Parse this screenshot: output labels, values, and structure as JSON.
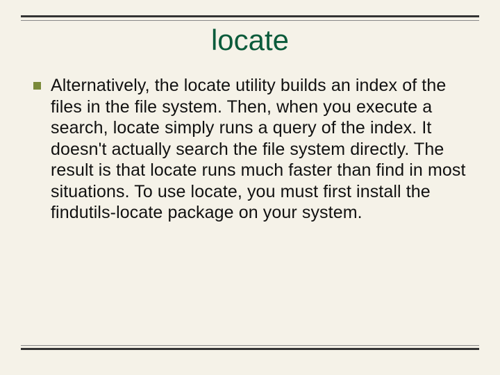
{
  "slide": {
    "title": "locate",
    "bullets": [
      {
        "text": "Alternatively, the locate utility builds an index of the files in the file system. Then, when you execute a search, locate simply runs a query of the index. It doesn't actually search the file system directly. The result is that locate runs much faster than find in most situations. To use locate, you must first install the findutils-locate package on your system."
      }
    ]
  }
}
